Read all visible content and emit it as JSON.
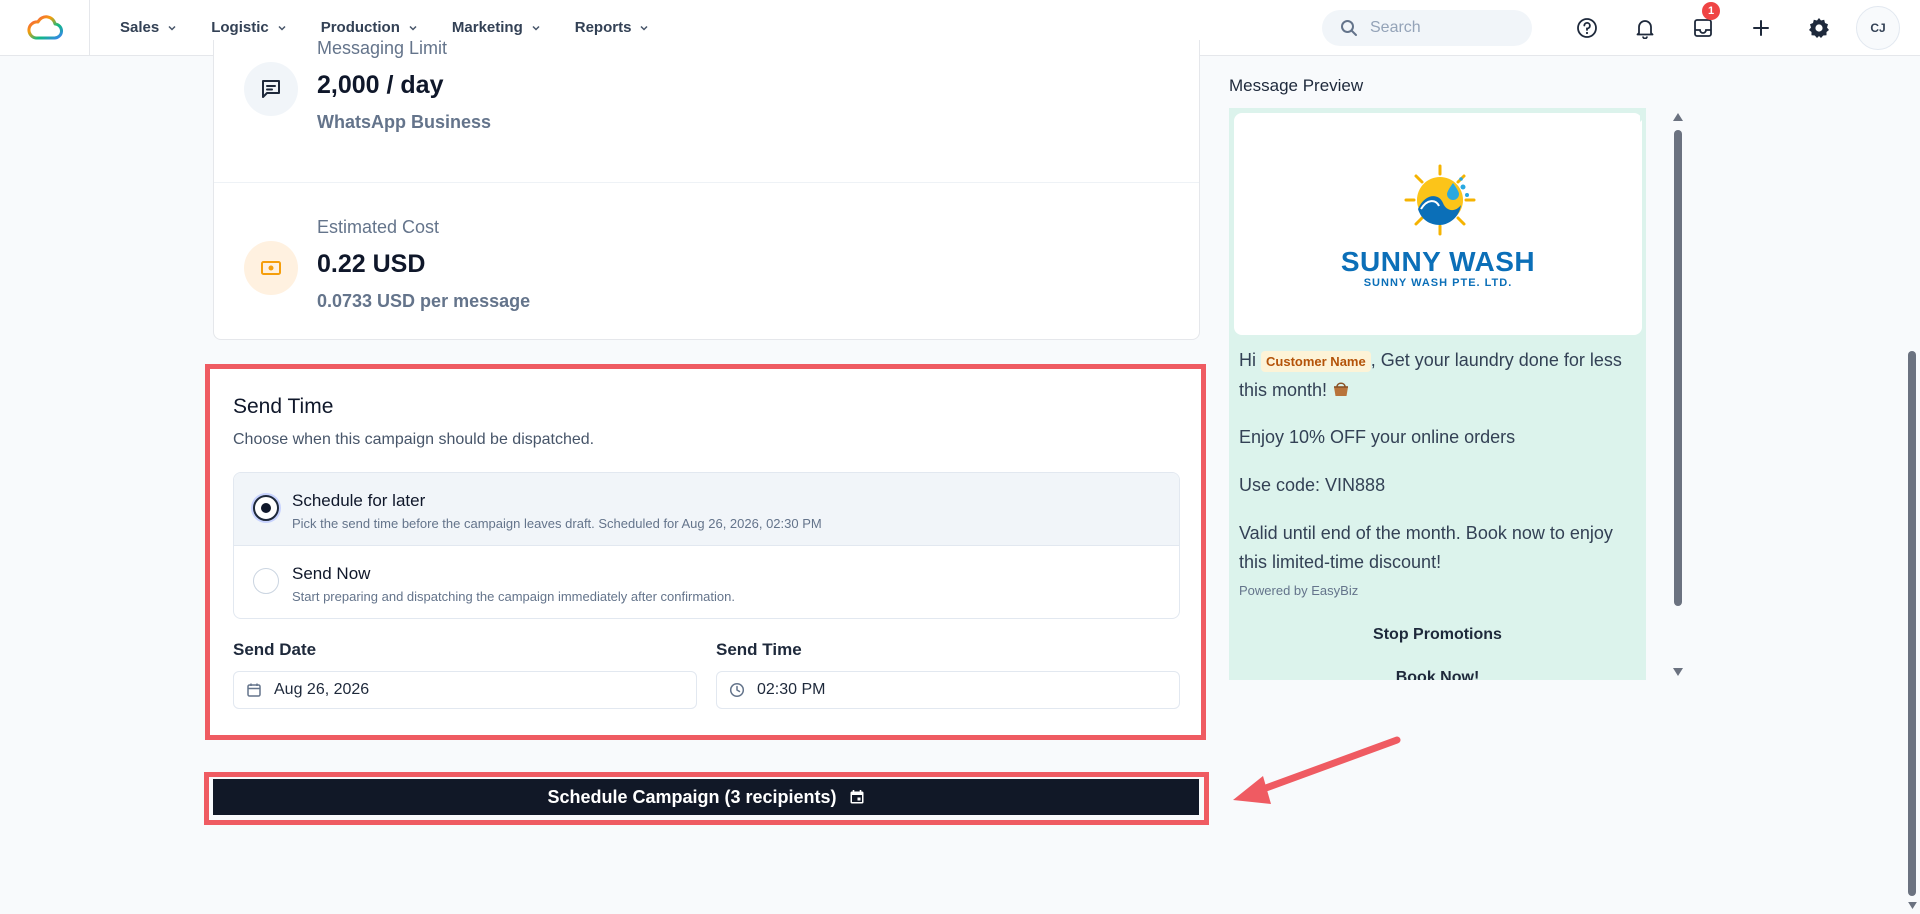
{
  "nav": {
    "items": [
      {
        "label": "Sales"
      },
      {
        "label": "Logistic"
      },
      {
        "label": "Production"
      },
      {
        "label": "Marketing"
      },
      {
        "label": "Reports"
      }
    ],
    "search_placeholder": "Search",
    "notification_count": "1",
    "avatar_initials": "CJ"
  },
  "stats": {
    "messaging": {
      "label": "Messaging Limit",
      "value": "2,000 / day",
      "sub": "WhatsApp Business",
      "icon": "chat-icon"
    },
    "cost": {
      "label": "Estimated Cost",
      "value": "0.22 USD",
      "sub": "0.0733 USD per message",
      "icon": "money-icon"
    }
  },
  "send_time": {
    "title": "Send Time",
    "description": "Choose when this campaign should be dispatched.",
    "options": [
      {
        "title": "Schedule for later",
        "desc": "Pick the send time before the campaign leaves draft. Scheduled for Aug 26, 2026, 02:30 PM",
        "selected": true
      },
      {
        "title": "Send Now",
        "desc": "Start preparing and dispatching the campaign immediately after confirmation.",
        "selected": false
      }
    ],
    "date_label": "Send Date",
    "date_value": "Aug 26, 2026",
    "time_label": "Send Time",
    "time_value": "02:30 PM"
  },
  "schedule_button": "Schedule Campaign (3 recipients)",
  "preview": {
    "title": "Message Preview",
    "brand_name": "SUNNY WASH",
    "brand_sub": "SUNNY WASH PTE. LTD.",
    "greeting_prefix": "Hi",
    "customer_chip": "Customer Name",
    "greeting_rest": ", Get your laundry done for less this month!",
    "line2": "Enjoy 10% OFF your online orders",
    "line3": "Use code: VIN888",
    "line4": "Valid until end of the month. Book now to enjoy this limited-time discount!",
    "powered": "Powered by EasyBiz",
    "button1": "Stop Promotions",
    "button2": "Book Now!"
  },
  "colors": {
    "highlight": "#ef5b62",
    "primary_button": "#111827",
    "bubble": "#dcf3ec"
  }
}
